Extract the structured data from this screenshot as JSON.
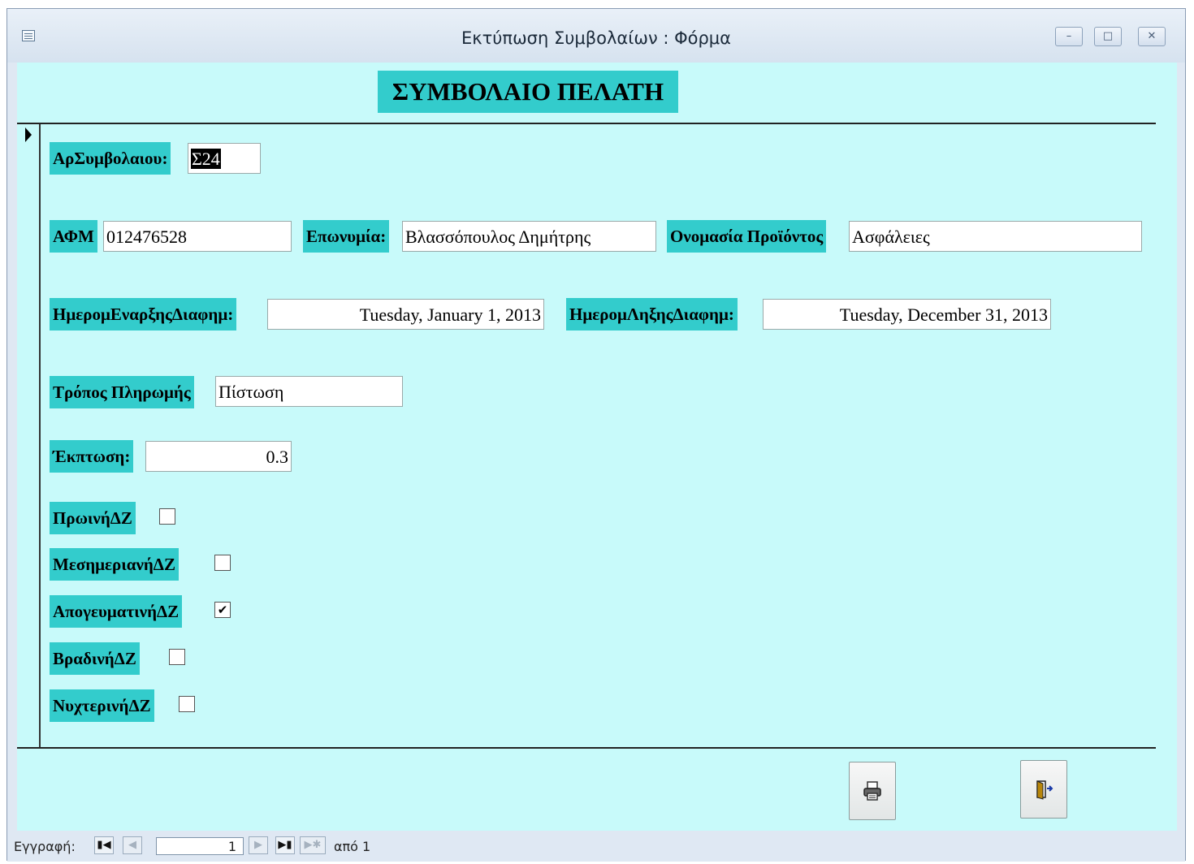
{
  "window": {
    "title": "Εκτύπωση Συμβολαίων : Φόρμα",
    "controls": [
      "minimize",
      "maximize",
      "close"
    ]
  },
  "form": {
    "title": "ΣΥΜΒΟΛΑΙΟ ΠΕΛΑΤΗ",
    "fields": {
      "contract_no": {
        "label": "ΑρΣυμβολαιου:",
        "value": "Σ24"
      },
      "afm": {
        "label": "ΑΦΜ",
        "value": "012476528"
      },
      "surname": {
        "label": "Επωνυμία:",
        "value": "Βλασσόπουλος Δημήτρης"
      },
      "product": {
        "label": "Ονομασία Προϊόντος",
        "value": "Ασφάλειες"
      },
      "start_date": {
        "label": "ΗμερομΕναρξηςΔιαφημ:",
        "value": "Tuesday, January 1, 2013"
      },
      "end_date": {
        "label": "ΗμερομΛηξηςΔιαφημ:",
        "value": "Tuesday, December 31, 2013"
      },
      "payment": {
        "label": "Τρόπος Πληρωμής",
        "value": "Πίστωση"
      },
      "discount": {
        "label": "Έκπτωση:",
        "value": "0.3"
      }
    },
    "checkboxes": [
      {
        "label": "ΠρωινήΔΖ",
        "checked": false
      },
      {
        "label": "ΜεσημεριανήΔΖ",
        "checked": false
      },
      {
        "label": "ΑπογευματινήΔΖ",
        "checked": true
      },
      {
        "label": "ΒραδινήΔΖ",
        "checked": false
      },
      {
        "label": "ΝυχτερινήΔΖ",
        "checked": false
      }
    ],
    "buttons": {
      "print_icon": "printer-icon",
      "exit_icon": "exit-door-icon"
    }
  },
  "navigation": {
    "label": "Εγγραφή:",
    "current": "1",
    "of_text": "από 1"
  },
  "colors": {
    "form_bg": "#c8fafa",
    "label_bg": "#33cccc",
    "check_mark": "✔"
  }
}
